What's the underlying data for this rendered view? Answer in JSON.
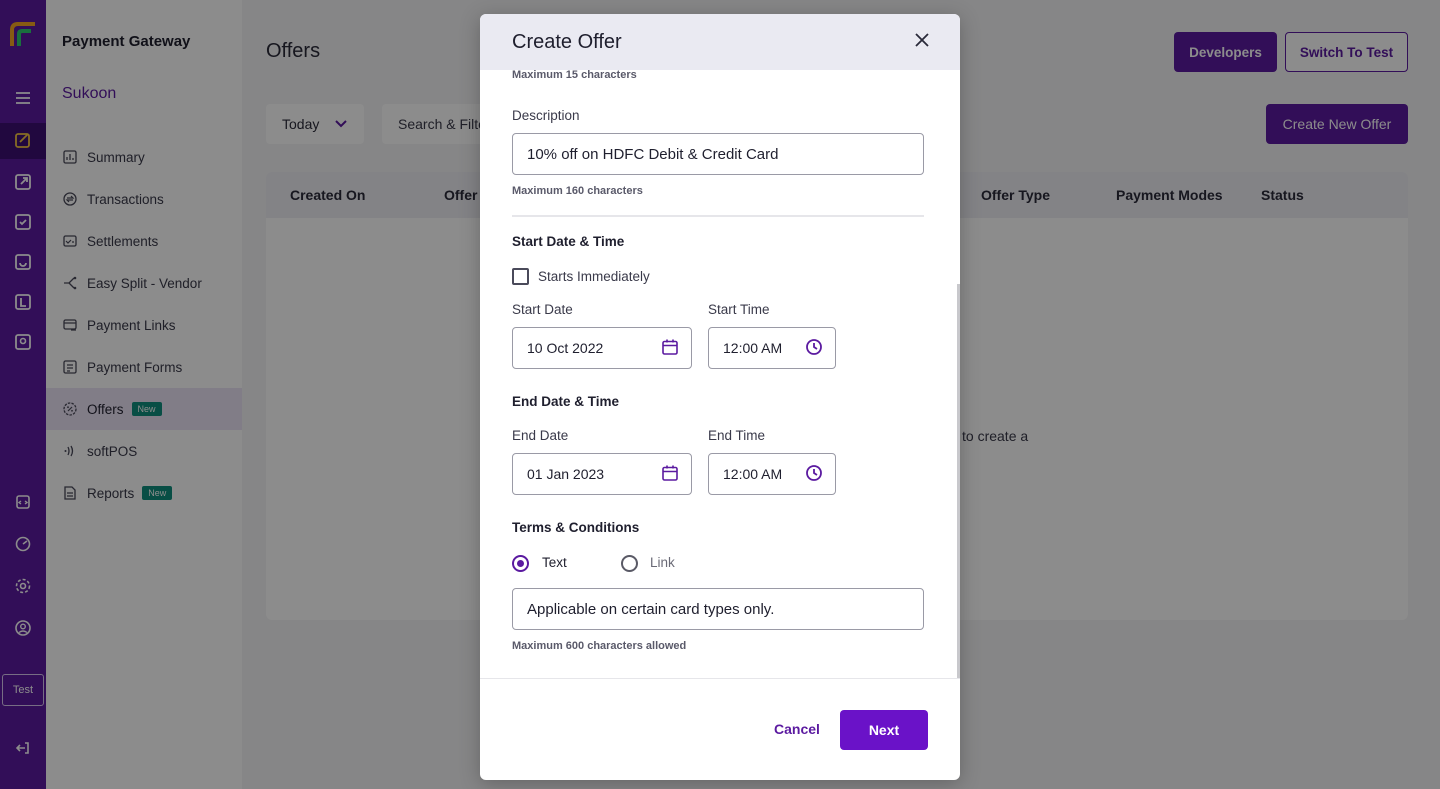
{
  "app": {
    "brand": "Payment Gateway",
    "merchant": "Sukoon",
    "env_badge": "Test"
  },
  "sidebar": {
    "items": [
      {
        "label": "Summary",
        "icon": "summary-icon",
        "badge": ""
      },
      {
        "label": "Transactions",
        "icon": "transactions-icon",
        "badge": ""
      },
      {
        "label": "Settlements",
        "icon": "settlements-icon",
        "badge": ""
      },
      {
        "label": "Easy Split - Vendor",
        "icon": "split-icon",
        "badge": ""
      },
      {
        "label": "Payment Links",
        "icon": "payment-links-icon",
        "badge": ""
      },
      {
        "label": "Payment Forms",
        "icon": "payment-forms-icon",
        "badge": ""
      },
      {
        "label": "Offers",
        "icon": "offers-icon",
        "badge": "New"
      },
      {
        "label": "softPOS",
        "icon": "softpos-icon",
        "badge": ""
      },
      {
        "label": "Reports",
        "icon": "reports-icon",
        "badge": "New"
      }
    ],
    "active": "Offers"
  },
  "header": {
    "title": "Offers",
    "developers_label": "Developers",
    "switch_label": "Switch To Test"
  },
  "toolbar": {
    "date_filter": "Today",
    "search_label": "Search & Filte",
    "create_label": "Create New Offer"
  },
  "table": {
    "columns": [
      "Created On",
      "Offer",
      "Offer Type",
      "Payment Modes",
      "Status"
    ],
    "empty_text": "to create a"
  },
  "modal": {
    "title": "Create Offer",
    "name_hint": "Maximum 15 characters",
    "description": {
      "label": "Description",
      "value": "10% off on HDFC Debit & Credit Card",
      "hint": "Maximum 160 characters"
    },
    "start": {
      "section": "Start Date & Time",
      "immediately_label": "Starts Immediately",
      "immediately_checked": false,
      "date_label": "Start Date",
      "date_value": "10 Oct 2022",
      "time_label": "Start Time",
      "time_value": "12:00 AM"
    },
    "end": {
      "section": "End Date & Time",
      "date_label": "End Date",
      "date_value": "01 Jan 2023",
      "time_label": "End Time",
      "time_value": "12:00 AM"
    },
    "terms": {
      "section": "Terms & Conditions",
      "options": [
        "Text",
        "Link"
      ],
      "selected": "Text",
      "value": "Applicable on certain card types only.",
      "hint": "Maximum 600 characters allowed"
    },
    "cancel_label": "Cancel",
    "next_label": "Next"
  },
  "colors": {
    "brand_purple": "#5b1aa0",
    "rail_active": "#3d0f73",
    "badge_green": "#0f8f7f",
    "next_button": "#6a12c8"
  }
}
